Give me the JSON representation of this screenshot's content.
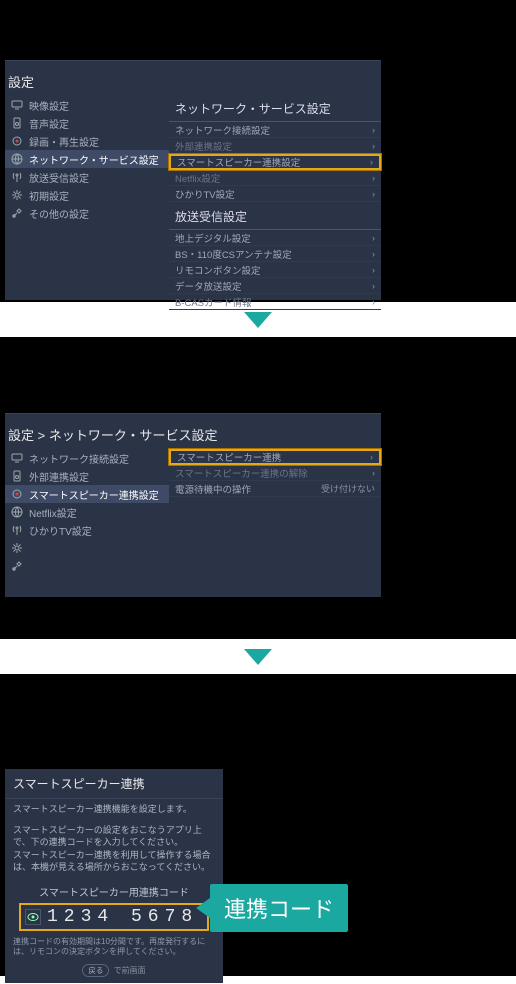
{
  "screen1": {
    "title": "設定",
    "sidebar": [
      {
        "icon": "display",
        "label": "映像設定"
      },
      {
        "icon": "speaker",
        "label": "音声設定"
      },
      {
        "icon": "rec",
        "label": "録画・再生設定"
      },
      {
        "icon": "net",
        "label": "ネットワーク・サービス設定",
        "selected": true
      },
      {
        "icon": "antenna",
        "label": "放送受信設定"
      },
      {
        "icon": "gear",
        "label": "初期設定"
      },
      {
        "icon": "tools",
        "label": "その他の設定"
      }
    ],
    "section1_header": "ネットワーク・サービス設定",
    "section1_items": [
      {
        "label": "ネットワーク接続設定"
      },
      {
        "label": "外部連携設定",
        "dim": true
      },
      {
        "label": "スマートスピーカー連携設定",
        "highlight": true
      },
      {
        "label": "Netflix設定",
        "dim": true
      },
      {
        "label": "ひかりTV設定"
      }
    ],
    "section2_header": "放送受信設定",
    "section2_items": [
      {
        "label": "地上デジタル設定"
      },
      {
        "label": "BS・110度CSアンテナ設定"
      },
      {
        "label": "リモコンボタン設定"
      },
      {
        "label": "データ放送設定"
      },
      {
        "label": "B-CASカード情報",
        "dim": true
      }
    ]
  },
  "screen2": {
    "breadcrumb": "設定 > ネットワーク・サービス設定",
    "sidebar": [
      {
        "icon": "display",
        "label": "ネットワーク接続設定"
      },
      {
        "icon": "speaker",
        "label": "外部連携設定"
      },
      {
        "icon": "rec",
        "label": "スマートスピーカー連携設定",
        "selected": true
      },
      {
        "icon": "net",
        "label": "Netflix設定"
      },
      {
        "icon": "antenna",
        "label": "ひかりTV設定"
      }
    ],
    "right_items": [
      {
        "label": "スマートスピーカー連携",
        "highlight": true
      },
      {
        "label": "スマートスピーカー連携の解除",
        "dim": true
      },
      {
        "label": "電源待機中の操作",
        "value": "受け付けない"
      }
    ]
  },
  "screen3": {
    "title": "スマートスピーカー連携",
    "desc1": "スマートスピーカー連携機能を設定します。",
    "desc2": "スマートスピーカーの設定をおこなうアプリ上で、下の連携コードを入力してください。\nスマートスピーカー連携を利用して操作する場合は、本機が見える場所からおこなってください。",
    "code_label": "スマートスピーカー用連携コード",
    "code": "1234 5678",
    "note": "連携コードの有効期間は10分間です。再度発行するには、リモコンの決定ボタンを押してください。",
    "footer_back": "戻る",
    "footer_text": "で前画面",
    "callout": "連携コード"
  }
}
